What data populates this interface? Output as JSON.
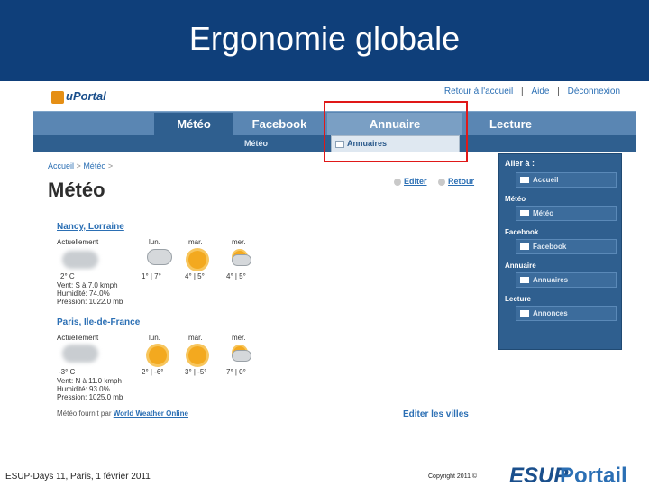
{
  "slide": {
    "title": "Ergonomie globale"
  },
  "portal": {
    "logo": "uPortal",
    "top_links": [
      "Retour à l'accueil",
      "Aide",
      "Déconnexion"
    ],
    "separator": "|",
    "tabs": [
      "Météo",
      "Facebook",
      "Annuaire",
      "Lecture"
    ],
    "subtab_meteo": "Météo",
    "subtab_annuaires": "Annuaires",
    "breadcrumb": [
      "Accueil",
      "Météo"
    ],
    "breadcrumb_sep": ">",
    "page_title": "Météo",
    "actions": {
      "edit": "Editer",
      "back": "Retour"
    },
    "cities": [
      {
        "name": "Nancy, Lorraine",
        "now_label": "Actuellement",
        "temp": "2° C",
        "wind": "Vent: S à 7.0 kmph",
        "humidity": "Humidité: 74.0%",
        "pressure": "Pression: 1022.0 mb",
        "days": [
          {
            "day": "lun.",
            "range": "1° | 7°"
          },
          {
            "day": "mar.",
            "range": "4° | 5°"
          },
          {
            "day": "mer.",
            "range": "4° | 5°"
          }
        ]
      },
      {
        "name": "Paris, Ile-de-France",
        "now_label": "Actuellement",
        "temp": "-3° C",
        "wind": "Vent: N à 11.0 kmph",
        "humidity": "Humidité: 93.0%",
        "pressure": "Pression: 1025.0 mb",
        "days": [
          {
            "day": "lun.",
            "range": "2° | -6°"
          },
          {
            "day": "mar.",
            "range": "3° | -5°"
          },
          {
            "day": "mer.",
            "range": "7° | 0°"
          }
        ]
      }
    ],
    "provider_text": "Météo fournit par",
    "provider_name": "World Weather Online",
    "edit_cities": "Editer les villes",
    "sidebar": {
      "title": "Aller à :",
      "groups": [
        {
          "label": "",
          "item": "Accueil"
        },
        {
          "label": "Météo",
          "item": "Météo"
        },
        {
          "label": "Facebook",
          "item": "Facebook"
        },
        {
          "label": "Annuaire",
          "item": "Annuaires"
        },
        {
          "label": "Lecture",
          "item": "Annonces"
        }
      ]
    }
  },
  "footer": {
    "left": "ESUP-Days 11, Paris, 1 février 2011",
    "copyright": "Copyright 2011 ©",
    "logo_esup": "ESUP",
    "logo_portail": "Portail"
  }
}
